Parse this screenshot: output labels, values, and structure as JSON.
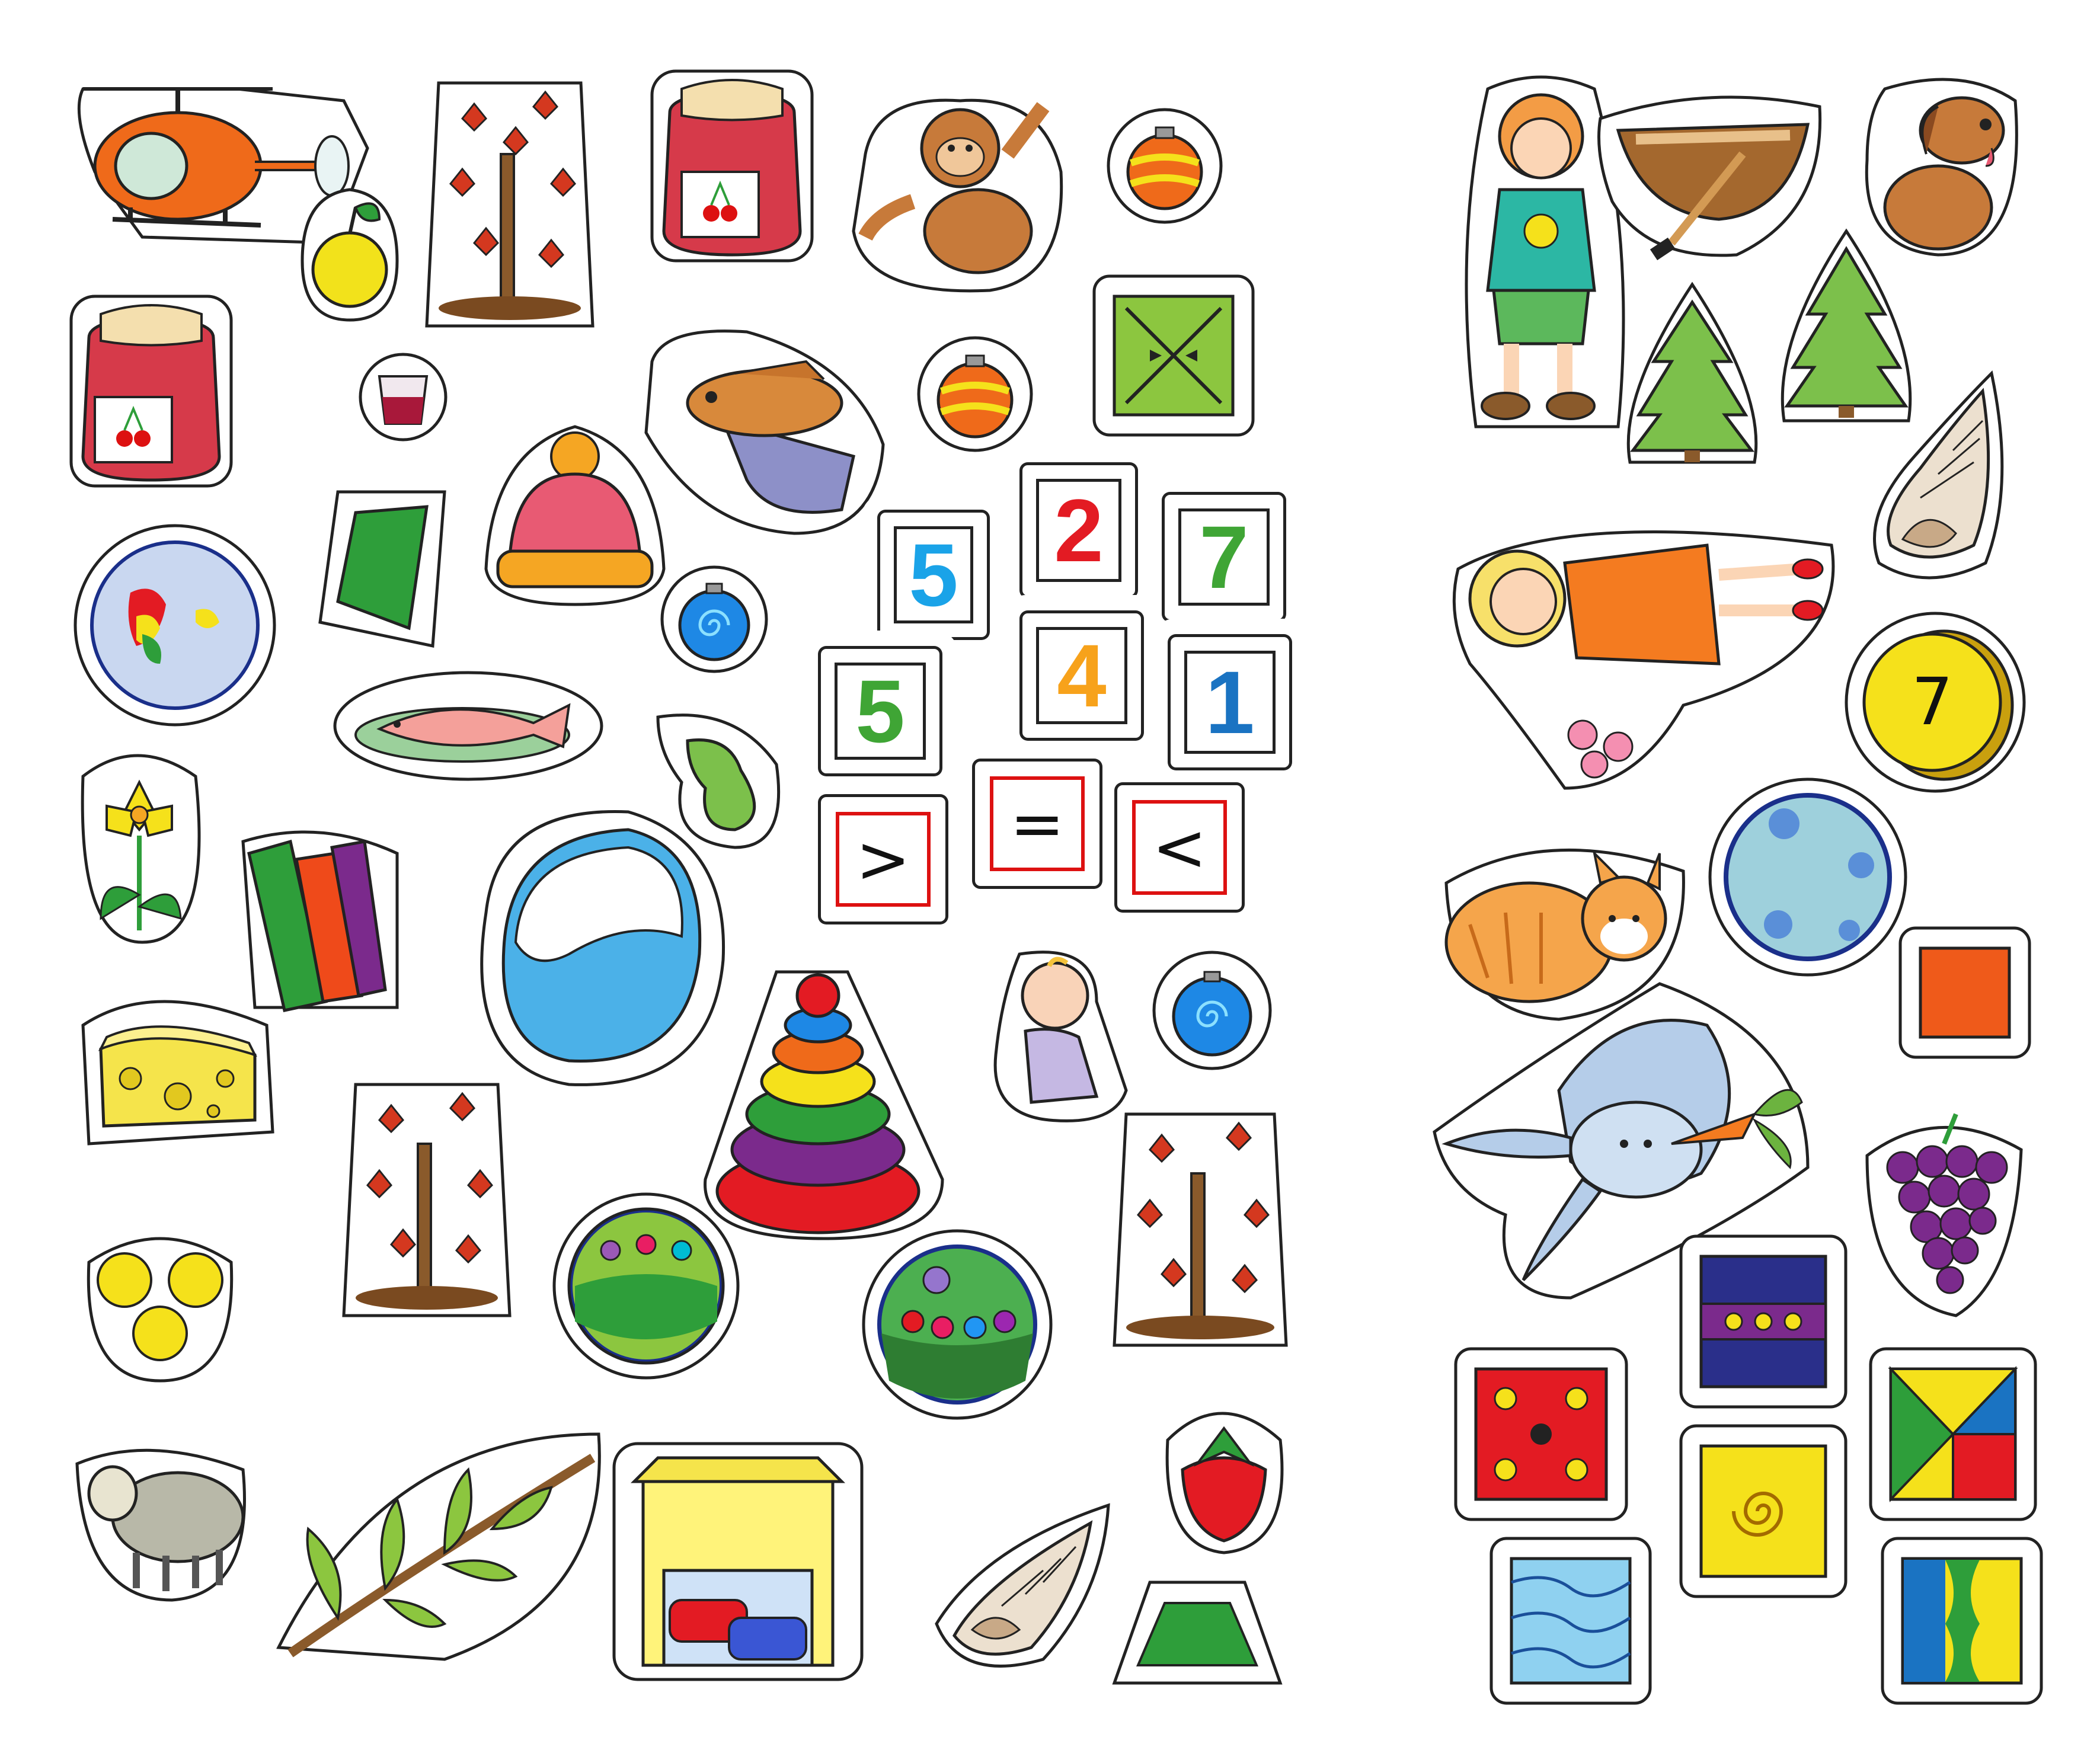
{
  "sheet": {
    "background": "#ffffff",
    "number_tiles": [
      {
        "value": "5",
        "color": "#1aa3e8"
      },
      {
        "value": "2",
        "color": "#e31b23"
      },
      {
        "value": "7",
        "color": "#3fa535"
      },
      {
        "value": "5",
        "color": "#3fa535"
      },
      {
        "value": "4",
        "color": "#f7a21b"
      },
      {
        "value": "1",
        "color": "#1a73c2"
      }
    ],
    "sign_tiles": [
      {
        "symbol": ">"
      },
      {
        "symbol": "="
      },
      {
        "symbol": "<"
      }
    ],
    "coin": {
      "value": "7"
    },
    "colors": {
      "outline": "#222222",
      "jam": "#d63a4a",
      "green": "#2e9e3a",
      "yellow": "#f5e11b",
      "orange": "#ef6a1a",
      "blue": "#1a73c2",
      "red": "#e31b23",
      "purple": "#7b2a8c"
    },
    "icons": [
      "helicopter-icon",
      "apple-icon",
      "autumn-tree-icon",
      "jam-jar-icon",
      "monkey-icon",
      "ornament-icon",
      "boy-icon",
      "rowboat-icon",
      "dog-icon",
      "fir-tree-icon",
      "seashell-icon",
      "girl-icon",
      "cat-icon",
      "ball-icon",
      "bunny-icon",
      "grapes-icon",
      "cheese-icon",
      "coins-icon",
      "sheep-icon",
      "branch-icon",
      "garage-icon",
      "strawberry-icon",
      "trapezoid-icon",
      "ring-pyramid-icon",
      "baby-icon",
      "fish-plate-icon",
      "pear-icon",
      "flower-icon",
      "books-icon",
      "puddle-icon",
      "knit-hat-icon",
      "glass-icon",
      "globe-icon",
      "fish-bucket-icon",
      "envelope-tile-icon",
      "dice-tile-icon",
      "spiral-tile-icon",
      "wave-tile-icon",
      "tangram-tile-icon",
      "stripe-tile-icon",
      "dots-tile-icon",
      "orange-square-icon",
      "quadrilateral-icon",
      "christmas-tree-circle-icon"
    ]
  }
}
